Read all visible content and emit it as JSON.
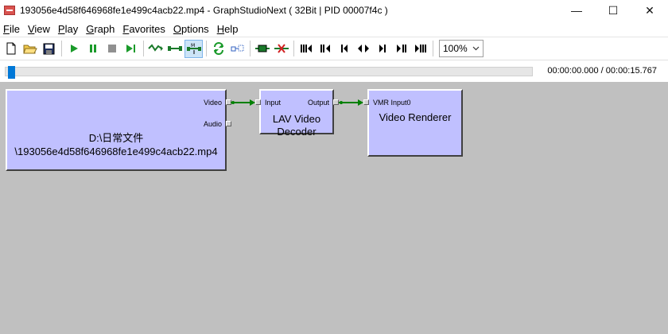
{
  "window": {
    "title": "193056e4d58f646968fe1e499c4acb22.mp4 - GraphStudioNext ( 32Bit | PID 00007f4c )",
    "minimize": "—",
    "maximize": "☐",
    "close": "✕"
  },
  "menu": {
    "items": [
      {
        "first": "F",
        "rest": "ile"
      },
      {
        "first": "V",
        "rest": "iew"
      },
      {
        "first": "P",
        "rest": "lay"
      },
      {
        "first": "G",
        "rest": "raph"
      },
      {
        "first": "F",
        "rest": "avorites"
      },
      {
        "first": "O",
        "rest": "ptions"
      },
      {
        "first": "H",
        "rest": "elp"
      }
    ]
  },
  "toolbar": {
    "zoom": "100%",
    "icons": [
      "new-file-icon",
      "open-folder-icon",
      "save-icon",
      "play-icon",
      "pause-icon",
      "stop-icon",
      "step-play-icon",
      "render-wave-icon",
      "connect-icon",
      "smart-connect-icon",
      "refresh-icon",
      "clock-icon",
      "insert-filter-icon",
      "remove-filter-icon",
      "seek-start-icon",
      "seek-back-icon",
      "step-back-icon",
      "frame-toggle-icon",
      "step-forward-icon",
      "seek-forward-icon",
      "seek-end-icon"
    ]
  },
  "seek": {
    "position_fraction": 0.0,
    "time": "00:00:00.000 / 00:00:15.767"
  },
  "graph": {
    "source": {
      "name_line1": "D:\\日常文件",
      "name_line2": "\\193056e4d58f646968fe1e499c4acb22.mp4",
      "pins": {
        "video": "Video",
        "audio": "Audio"
      }
    },
    "decoder": {
      "name_line1": "LAV Video",
      "name_line2": "Decoder",
      "pins": {
        "input": "Input",
        "output": "Output"
      }
    },
    "renderer": {
      "name_line1": "Video Renderer",
      "pins": {
        "input": "VMR Input0"
      }
    }
  },
  "colors": {
    "filter_fill": "#c0c0ff",
    "canvas": "#c0c0c0",
    "connection": "#008000"
  }
}
